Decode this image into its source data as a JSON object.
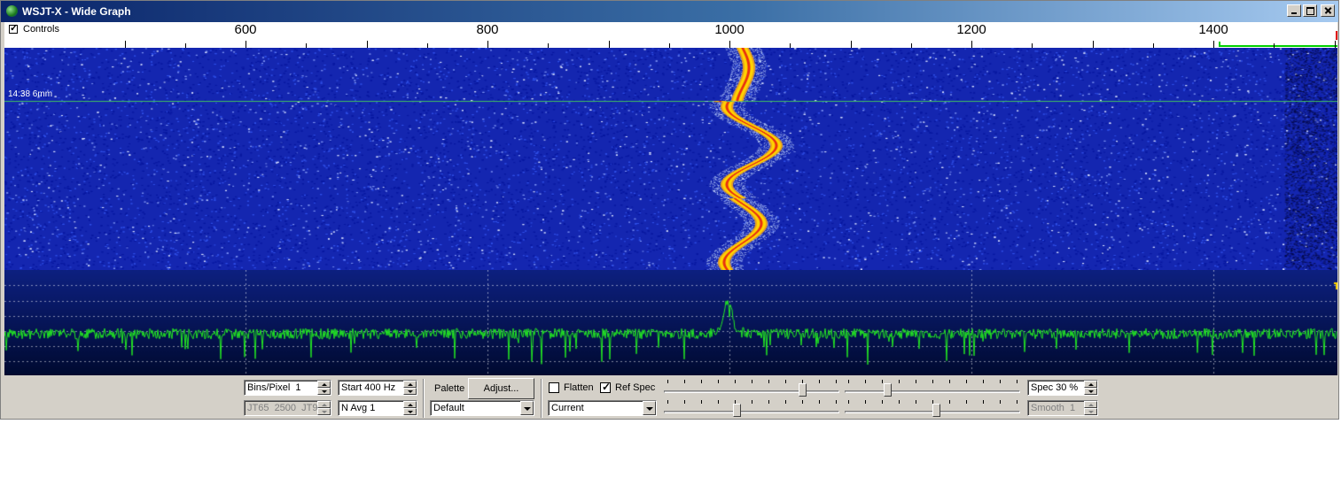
{
  "window": {
    "title": "WSJT-X - Wide Graph"
  },
  "scale": {
    "controls_label": "Controls",
    "controls_checked": true,
    "labels": [
      "600",
      "800",
      "1000",
      "1200",
      "1400"
    ]
  },
  "waterfall": {
    "time_label": "14:38   6mm"
  },
  "controls": {
    "bins_per_pixel": "Bins/Pixel  1",
    "mode_info": "JT65  2500  JT9",
    "start": "Start 400 Hz",
    "navg": "N Avg 1",
    "palette_label": "Palette",
    "adjust_label": "Adjust...",
    "palette_value": "Default",
    "flatten_label": "Flatten",
    "flatten_checked": false,
    "refspec_label": "Ref Spec",
    "refspec_checked": true,
    "spectrum_select": "Current",
    "spec": "Spec 30 %",
    "smooth": "Smooth  1"
  },
  "sliders": {
    "top_left_level": 0.8,
    "top_right_level": 0.23,
    "bottom_left_level": 0.41,
    "bottom_right_level": 0.52
  },
  "colors": {
    "waterfall_bg": "#1426b0",
    "signal": "#ffd400",
    "signal_core": "#e83010",
    "spectrum_bg": "#0a1a70",
    "spectrum_line": "#22e622",
    "timestamp_line": "#40c060"
  }
}
